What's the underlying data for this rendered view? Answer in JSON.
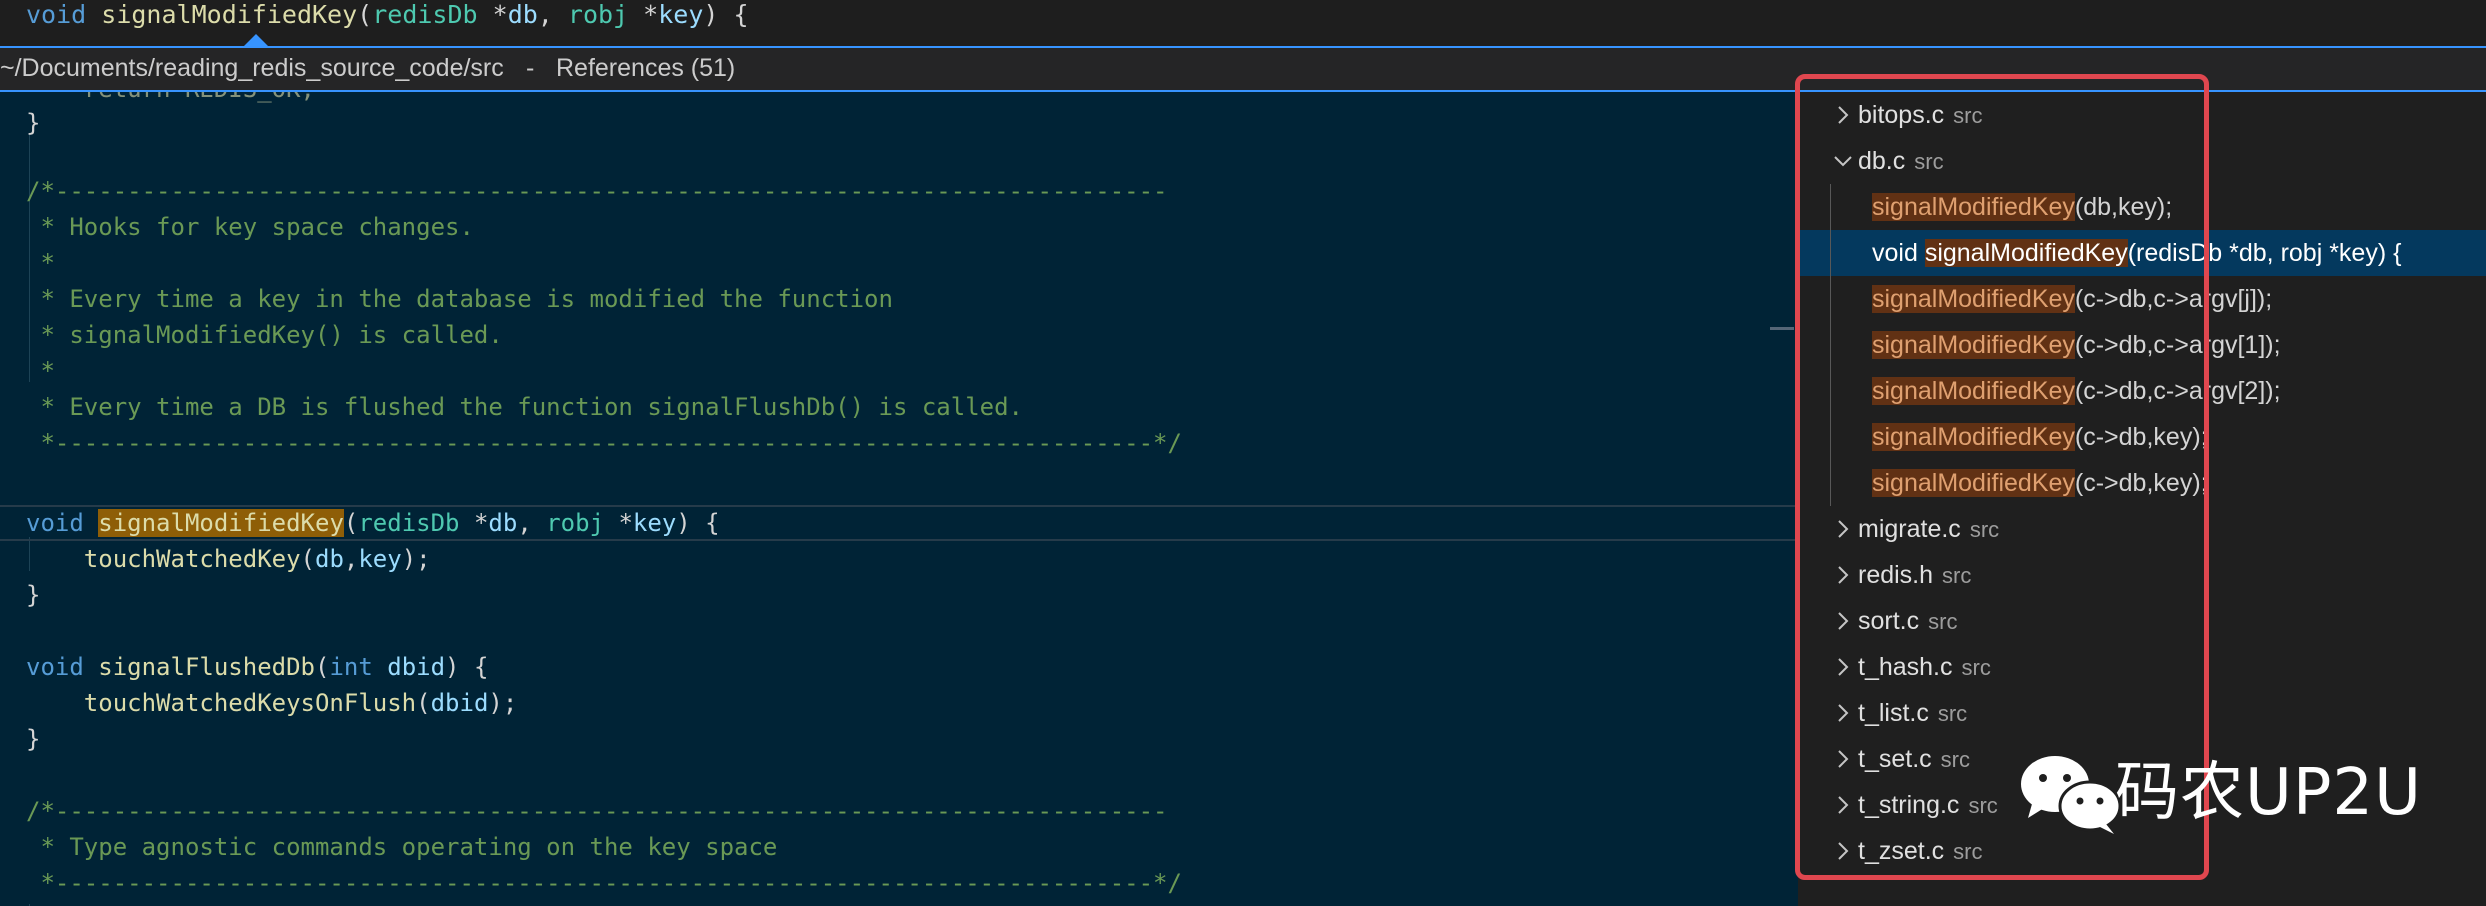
{
  "top_line": {
    "kw_void": "void",
    "fn_name": "signalModifiedKey",
    "open_paren": "(",
    "type1": "redisDb",
    "star1": " *",
    "param1": "db",
    "comma": ", ",
    "type2": "robj",
    "star2": " *",
    "param2": "key",
    "close": ") {"
  },
  "peek_header": {
    "path": "~/Documents/reading_redis_source_code/src",
    "separator": " - ",
    "title": "References (51)"
  },
  "editor": {
    "l1": "    return REDIS_OK;",
    "l2": "}",
    "l4": "/*-----------------------------------------------------------------------------",
    "l5": " * Hooks for key space changes.",
    "l6": " *",
    "l7": " * Every time a key in the database is modified the function",
    "l8": " * signalModifiedKey() is called.",
    "l9": " *",
    "l10": " * Every time a DB is flushed the function signalFlushDb() is called.",
    "l11": " *----------------------------------------------------------------------------*/",
    "l13_void": "void",
    "l13_fn": "signalModifiedKey",
    "l13_paren": "(",
    "l13_type1": "redisDb",
    "l13_star1": " *",
    "l13_p1": "db",
    "l13_comma": ", ",
    "l13_type2": "robj",
    "l13_star2": " *",
    "l13_p2": "key",
    "l13_close": ") {",
    "l14_fn": "    touchWatchedKey",
    "l14_open": "(",
    "l14_a1": "db",
    "l14_c": ",",
    "l14_a2": "key",
    "l14_close": ");",
    "l15": "}",
    "l17_void": "void",
    "l17_fn": " signalFlushedDb",
    "l17_open": "(",
    "l17_int": "int",
    "l17_p": " dbid",
    "l17_close": ") {",
    "l18_fn": "    touchWatchedKeysOnFlush",
    "l18_open": "(",
    "l18_a": "dbid",
    "l18_close": ");",
    "l19": "}",
    "l21": "/*-----------------------------------------------------------------------------",
    "l22": " * Type agnostic commands operating on the key space",
    "l23": " *----------------------------------------------------------------------------*/"
  },
  "references": {
    "files": [
      {
        "name": "bitops.c",
        "path": "src",
        "expanded": false
      },
      {
        "name": "db.c",
        "path": "src",
        "expanded": true
      },
      {
        "name": "migrate.c",
        "path": "src",
        "expanded": false
      },
      {
        "name": "redis.h",
        "path": "src",
        "expanded": false
      },
      {
        "name": "sort.c",
        "path": "src",
        "expanded": false
      },
      {
        "name": "t_hash.c",
        "path": "src",
        "expanded": false
      },
      {
        "name": "t_list.c",
        "path": "src",
        "expanded": false
      },
      {
        "name": "t_set.c",
        "path": "src",
        "expanded": false
      },
      {
        "name": "t_string.c",
        "path": "src",
        "expanded": false
      },
      {
        "name": "t_zset.c",
        "path": "src",
        "expanded": false
      }
    ],
    "db_refs": [
      {
        "pre": "",
        "match": "signalModifiedKey",
        "post": "(db,key);"
      },
      {
        "pre": "void ",
        "match": "signalModifiedKey",
        "post": "(redisDb *db, robj *key) {"
      },
      {
        "pre": "",
        "match": "signalModifiedKey",
        "post": "(c->db,c->argv[j]);"
      },
      {
        "pre": "",
        "match": "signalModifiedKey",
        "post": "(c->db,c->argv[1]);"
      },
      {
        "pre": "",
        "match": "signalModifiedKey",
        "post": "(c->db,c->argv[2]);"
      },
      {
        "pre": "",
        "match": "signalModifiedKey",
        "post": "(c->db,key);"
      },
      {
        "pre": "",
        "match": "signalModifiedKey",
        "post": "(c->db,key);"
      }
    ]
  },
  "watermark": {
    "text": "码农UP2U",
    "icon": "wechat-icon"
  },
  "colors": {
    "editor_bg": "#002336",
    "highlight": "#8e5e07",
    "reference_highlight": "#613114",
    "peek_accent": "#3794ff",
    "annotation_box": "#e0474f"
  }
}
